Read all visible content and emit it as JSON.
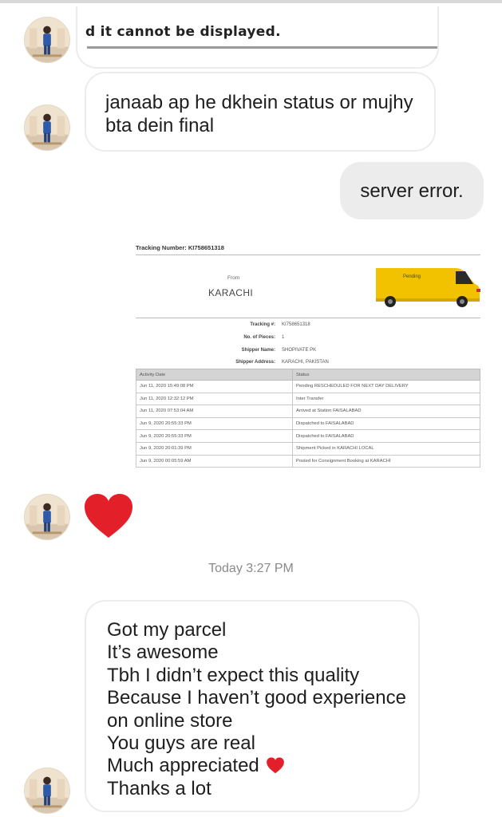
{
  "chat": {
    "clipped_message": "d it cannot be displayed.",
    "message1": "janaab ap he dkhein status or mujhy bta dein final",
    "message2": "server error.",
    "timestamp": "Today 3:27 PM",
    "message3_lines": [
      "Got my parcel",
      "It’s awesome",
      "Tbh I didn’t expect this quality",
      "Because I haven’t good experience",
      "on online store",
      "You guys are real",
      "Much appreciated",
      "Thanks a lot"
    ],
    "reaction_emoji": "red-heart",
    "inline_emoji": "red-heart"
  },
  "tracking": {
    "tracking_number_label": "Tracking Number: KI758651318",
    "from_label": "From",
    "from_value": "KARACHI",
    "van_status": "Pending",
    "details": [
      {
        "key": "Tracking #:",
        "value": "KI758651318"
      },
      {
        "key": "No. of Pieces:",
        "value": "1"
      },
      {
        "key": "Shipper Name:",
        "value": "SHOPIVATE PK"
      },
      {
        "key": "Shipper Address:",
        "value": "KARACHI, PAKISTAN"
      }
    ],
    "columns": [
      "Activity Date",
      "Status"
    ],
    "rows": [
      {
        "date": "Jun 11, 2020 15:49:08 PM",
        "status": "Pending RESCHEDULED FOR NEXT DAY DELIVERY"
      },
      {
        "date": "Jun 11, 2020 12:32:12 PM",
        "status": "Inter Transfer"
      },
      {
        "date": "Jun 11, 2020 07:53:04 AM",
        "status": "Arrived at Station FAISALABAD"
      },
      {
        "date": "Jun 9, 2020 20:55:33 PM",
        "status": "Dispatched to FAISALABAD"
      },
      {
        "date": "Jun 9, 2020 20:55:33 PM",
        "status": "Dispatched to FAISALABAD"
      },
      {
        "date": "Jun 9, 2020 20:01:39 PM",
        "status": "Shipment Picked in KARACHI LOCAL"
      },
      {
        "date": "Jun 9, 2020 00:05:59 AM",
        "status": "Posted for Consignment Booking at KARACHI"
      }
    ]
  },
  "colors": {
    "heart": "#e3202a",
    "outgoing_bubble": "#ececec",
    "incoming_border": "#ececec",
    "timestamp": "#8a8a8a",
    "van": "#f2c200"
  }
}
